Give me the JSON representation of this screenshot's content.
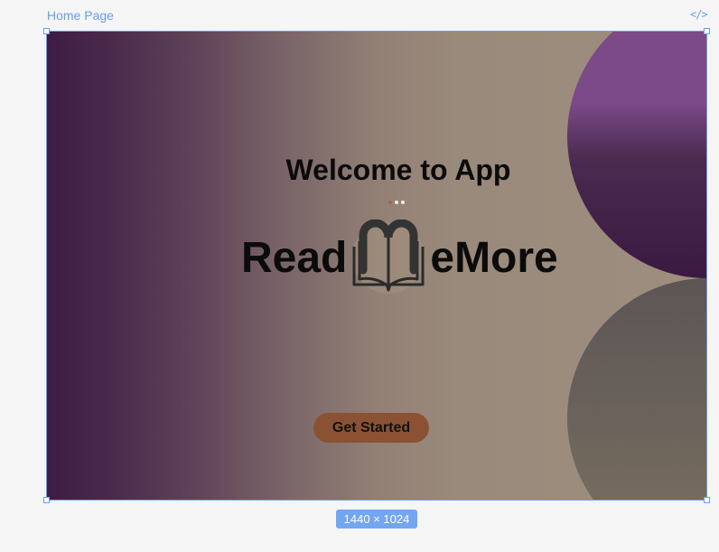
{
  "canvas": {
    "frame_label": "Home Page",
    "code_icon": "code-icon",
    "size_label": "1440 × 1024",
    "selection_color": "#6b9de8"
  },
  "page": {
    "title": "Welcome to App",
    "brand_left": "Read",
    "brand_right": "eMore",
    "brand_icon": "open-book-m-icon",
    "cta_label": "Get Started",
    "cta_color": "#8a5233",
    "pager_dots": [
      {
        "color": "#a5673c",
        "active": true
      },
      {
        "color": "#f3eee8",
        "active": false
      },
      {
        "color": "#f3eee8",
        "active": false
      }
    ]
  }
}
